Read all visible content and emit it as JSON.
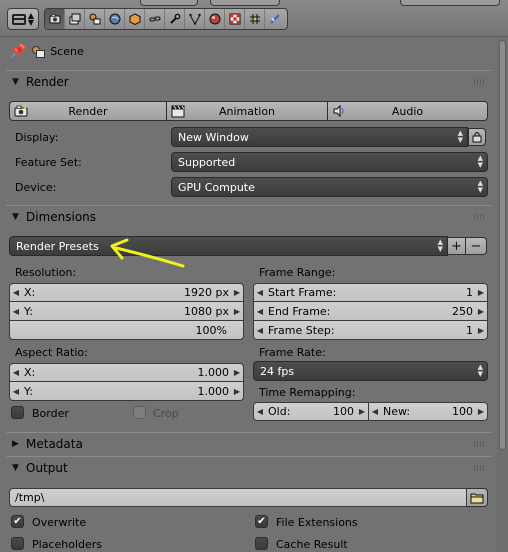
{
  "header": {
    "editor_type_icon": "properties-editor-icon",
    "context_tabs": [
      {
        "name": "render-tab",
        "icon": "camera-icon",
        "active": true
      },
      {
        "name": "render-layers-tab",
        "icon": "render-layers-icon",
        "active": false
      },
      {
        "name": "scene-tab",
        "icon": "scene-icon",
        "active": false
      },
      {
        "name": "world-tab",
        "icon": "world-icon",
        "active": false
      },
      {
        "name": "object-tab",
        "icon": "object-icon",
        "active": false
      },
      {
        "name": "constraints-tab",
        "icon": "constraint-icon",
        "active": false
      },
      {
        "name": "modifiers-tab",
        "icon": "wrench-icon",
        "active": false
      },
      {
        "name": "data-tab",
        "icon": "mesh-data-icon",
        "active": false
      },
      {
        "name": "material-tab",
        "icon": "material-icon",
        "active": false
      },
      {
        "name": "texture-tab",
        "icon": "texture-icon",
        "active": false
      },
      {
        "name": "particles-tab",
        "icon": "particles-icon",
        "active": false
      },
      {
        "name": "physics-tab",
        "icon": "physics-icon",
        "active": false
      }
    ]
  },
  "context_path": {
    "label": "Scene"
  },
  "render_panel": {
    "title": "Render",
    "buttons": {
      "render": "Render",
      "animation": "Animation",
      "audio": "Audio"
    },
    "display_label": "Display:",
    "display_value": "New Window",
    "feature_set_label": "Feature Set:",
    "feature_set_value": "Supported",
    "device_label": "Device:",
    "device_value": "GPU Compute"
  },
  "dimensions_panel": {
    "title": "Dimensions",
    "presets_value": "Render Presets",
    "resolution_label": "Resolution:",
    "res_x_label": "X:",
    "res_x_value": "1920 px",
    "res_y_label": "Y:",
    "res_y_value": "1080 px",
    "res_percent": "100%",
    "aspect_label": "Aspect Ratio:",
    "aspect_x_label": "X:",
    "aspect_x_value": "1.000",
    "aspect_y_label": "Y:",
    "aspect_y_value": "1.000",
    "border_label": "Border",
    "crop_label": "Crop",
    "frame_range_label": "Frame Range:",
    "start_frame_label": "Start Frame:",
    "start_frame_value": "1",
    "end_frame_label": "End Frame:",
    "end_frame_value": "250",
    "frame_step_label": "Frame Step:",
    "frame_step_value": "1",
    "frame_rate_label": "Frame Rate:",
    "frame_rate_value": "24 fps",
    "time_remap_label": "Time Remapping:",
    "old_label": "Old:",
    "old_value": "100",
    "new_label": "New:",
    "new_value": "100"
  },
  "metadata_panel": {
    "title": "Metadata"
  },
  "output_panel": {
    "title": "Output",
    "path_value": "/tmp\\",
    "overwrite_label": "Overwrite",
    "overwrite_checked": true,
    "file_extensions_label": "File Extensions",
    "file_extensions_checked": true,
    "placeholders_label": "Placeholders",
    "placeholders_checked": false,
    "cache_result_label": "Cache Result",
    "cache_result_checked": false
  },
  "annotation": {
    "color": "#f2f21a"
  }
}
